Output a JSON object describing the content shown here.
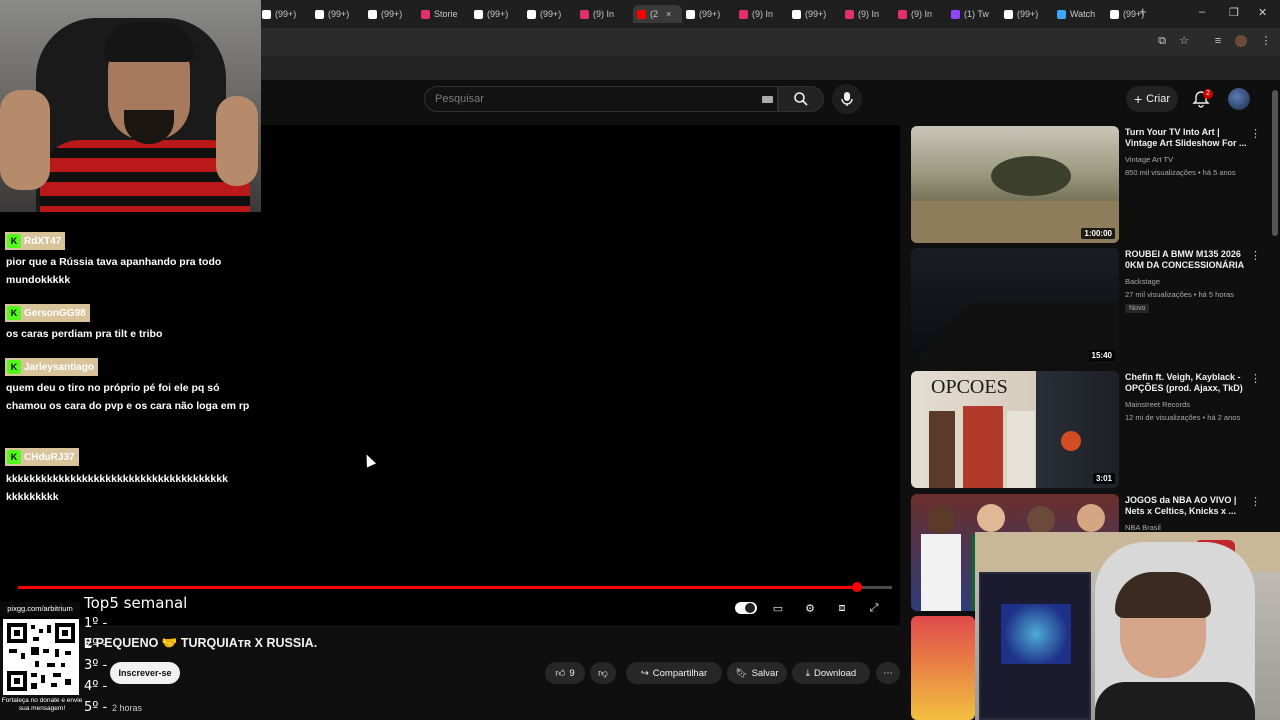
{
  "browser": {
    "tabs": [
      {
        "label": "(99+)",
        "color": "#ffffff"
      },
      {
        "label": "(99+)",
        "color": "#ffffff"
      },
      {
        "label": "(99+)",
        "color": "#ffffff"
      },
      {
        "label": "Storie",
        "color": "#e1306c"
      },
      {
        "label": "(99+)",
        "color": "#ffffff"
      },
      {
        "label": "(99+)",
        "color": "#ffffff"
      },
      {
        "label": "(9) In",
        "color": "#e1306c"
      },
      {
        "label": "(2",
        "color": "#ff0000",
        "active": true
      },
      {
        "label": "(99+)",
        "color": "#ffffff"
      },
      {
        "label": "(9) In",
        "color": "#e1306c"
      },
      {
        "label": "(99+)",
        "color": "#ffffff"
      },
      {
        "label": "(9) In",
        "color": "#e1306c"
      },
      {
        "label": "(9) In",
        "color": "#e1306c"
      },
      {
        "label": "(1) Tw",
        "color": "#9146ff"
      },
      {
        "label": "(99+)",
        "color": "#ffffff"
      },
      {
        "label": "Watch",
        "color": "#3ea6ff"
      },
      {
        "label": "(99+)",
        "color": "#ffffff"
      }
    ],
    "new_tab": "+",
    "window_controls": [
      "–",
      "❐",
      "✕"
    ]
  },
  "youtube": {
    "search_placeholder": "Pesquisar",
    "create_label": "Criar",
    "notification_count": "2"
  },
  "chat": [
    {
      "user": "RdXT47",
      "message": "pior que a Rússia tava apanhando pra todo mundokkkkk"
    },
    {
      "user": "GersonGG98",
      "message": "os caras perdiam pra tilt e tribo"
    },
    {
      "user": "Jarleysantiago",
      "message": "quem deu o tiro no próprio pé foi ele pq só chamou os cara do pvp e os cara não loga em rp"
    },
    {
      "user": "CHduRJ37",
      "message": "kkkkkkkkkkkkkkkkkkkkkkkkkkkkkkkkkkkkkk kkkkkkkkk"
    }
  ],
  "player": {
    "progress": 0.96
  },
  "video": {
    "title": "E PEQUENO 🤝 TURQUIAᴛʀ X RUSSIA.",
    "subscribe": "Inscrever-se",
    "date": "2 horas",
    "likes": "9",
    "share": "Compartilhar",
    "save": "Salvar",
    "download": "Download"
  },
  "overlay": {
    "pix_label": "pixgg.com/arbitrium",
    "qr_caption": "Fortaleça no donate e envie sua mensagem!",
    "top5_title": "Top5 semanal",
    "ranks": [
      "1º -",
      "2º -",
      "3º -",
      "4º -",
      "5º -"
    ]
  },
  "recommendations": [
    {
      "title": "Turn Your TV Into Art | Vintage Art Slideshow For ...",
      "channel": "Vintage Art TV",
      "meta": "850 mil visualizações • há 5 anos",
      "duration": "1:00:00",
      "thumb": "#8a8a6e"
    },
    {
      "title": "ROUBEI A BMW M135 2026 0KM DA CONCESSIONÁRIA",
      "channel": "Backstage",
      "meta": "27 mil visualizações • há 5 horas",
      "duration": "15:40",
      "badge": "Novo",
      "thumb": "#1a1d24"
    },
    {
      "title": "Chefin ft. Veigh, Kayblack - OPÇÕES (prod. Ajaxx, TkD)",
      "channel": "Mainstreet Records",
      "meta": "12 mi de visualizações • há 2 anos",
      "duration": "3:01",
      "thumb": "#3a2a24"
    },
    {
      "title": "JOGOS da NBA AO VIVO | Nets x Celtics, Knicks x ...",
      "channel": "NBA Brasil",
      "meta": "",
      "thumb": "#4a2b2a"
    }
  ],
  "rec3_thumb_text": "OPCOES"
}
